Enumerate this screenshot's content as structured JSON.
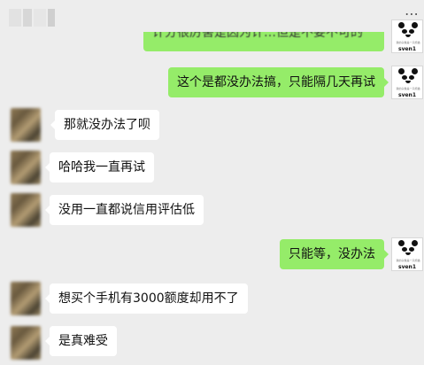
{
  "header": {
    "menu_icon": "more-icon",
    "menu_glyph": "⋯"
  },
  "messages": [
    {
      "side": "out",
      "text": "计分很厉害是因为计…但是不要不可的"
    },
    {
      "side": "out",
      "text": "这个是都没办法搞，只能隔几天再试"
    },
    {
      "side": "in",
      "text": "那就没办法了呗"
    },
    {
      "side": "in",
      "text": "哈哈我一直再试"
    },
    {
      "side": "in",
      "text": "没用一直都说信用评估低"
    },
    {
      "side": "out",
      "text": "只能等，没办法"
    },
    {
      "side": "in",
      "text": "想买个手机有3000额度却用不了"
    },
    {
      "side": "in",
      "text": "是真难受"
    }
  ],
  "self_avatar": {
    "tagline": "我的头像是一只熊猫",
    "name": "sven1"
  },
  "colors": {
    "background": "#ededed",
    "outgoing_bubble": "#95ec69",
    "incoming_bubble": "#ffffff"
  }
}
